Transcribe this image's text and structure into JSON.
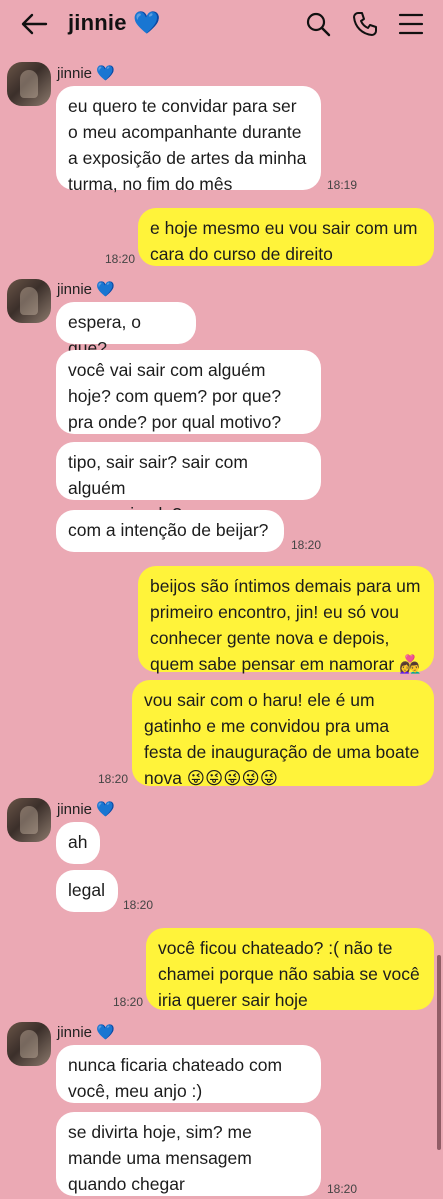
{
  "header": {
    "title": "jinnie",
    "title_emoji": "💙",
    "icons": [
      "back-arrow-icon",
      "search-icon",
      "phone-icon",
      "menu-icon"
    ]
  },
  "colors": {
    "background": "#eba9b4",
    "incoming_bubble": "#ffffff",
    "outgoing_bubble": "#fff33a",
    "heart": "#3da5f0"
  },
  "groups": {
    "g1": {
      "sender": "jinnie 💙"
    },
    "g2": {
      "sender": "jinnie 💙"
    },
    "g3": {
      "sender": "jinnie 💙"
    },
    "g4": {
      "sender": "jinnie 💙"
    }
  },
  "messages": {
    "m1": {
      "text": "eu quero te convidar para ser\no meu acompanhante durante\na exposição de artes da minha\nturma, no fim do mês",
      "time": "18:19"
    },
    "m2": {
      "text": "e hoje mesmo eu vou sair com um\ncara do curso de direito",
      "time": "18:20"
    },
    "m3": {
      "text": "espera, o que?"
    },
    "m4": {
      "text": "você vai sair com alguém\nhoje? com quem? por que?\npra onde? por qual motivo?"
    },
    "m5": {
      "text": "tipo, sair sair? sair com alguém\nsem amizade?"
    },
    "m6": {
      "text": "com a intenção de beijar?",
      "time": "18:20"
    },
    "m7": {
      "text": "beijos são íntimos demais para um\nprimeiro encontro, jin! eu só vou\nconhecer gente nova e depois,\nquem sabe pensar em namorar 👩‍❤️‍👨"
    },
    "m8": {
      "text": "vou sair com o haru! ele é um\ngatinho e me convidou pra uma\nfesta de inauguração de uma boate\nnova 😜😜😜😜😜",
      "time": "18:20"
    },
    "m9": {
      "text": "ah"
    },
    "m10": {
      "text": "legal",
      "time": "18:20"
    },
    "m11": {
      "text": "você ficou chateado? :( não te\nchamei porque não sabia se você\niria querer sair hoje",
      "time": "18:20"
    },
    "m12": {
      "text": "nunca ficaria chateado com\nvocê, meu anjo :)"
    },
    "m13": {
      "text": "se divirta hoje, sim? me\nmande uma mensagem\nquando chegar",
      "time": "18:20"
    }
  }
}
